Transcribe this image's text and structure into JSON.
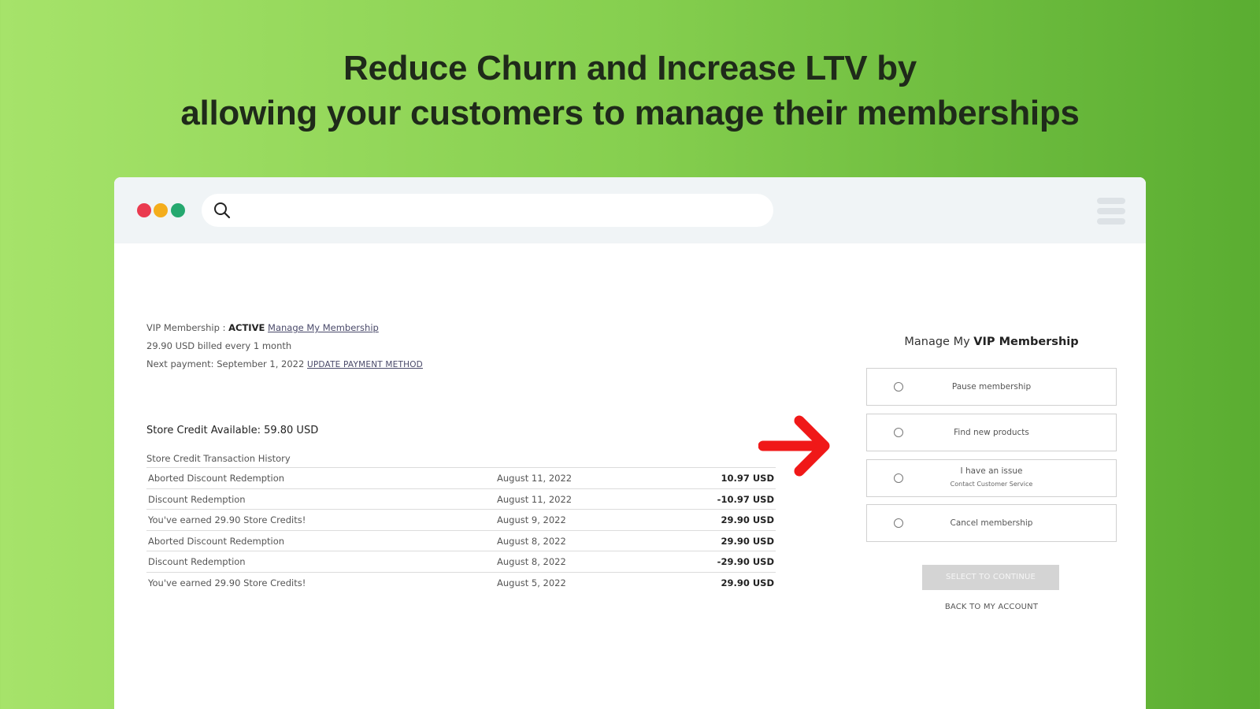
{
  "headline": {
    "line1": "Reduce Churn and Increase LTV by",
    "line2": "allowing your customers to manage their memberships"
  },
  "browser": {
    "search_placeholder": "",
    "dot_colors": [
      "#ea3a4f",
      "#f4ad1c",
      "#25a86f"
    ]
  },
  "membership": {
    "label": "VIP Membership : ",
    "status": "ACTIVE",
    "manage_link": "Manage My Membership",
    "billing": "29.90 USD billed every 1 month",
    "next_payment": "Next payment: September 1, 2022 ",
    "update_payment_link": "UPDATE PAYMENT METHOD"
  },
  "store_credit": {
    "available": "Store Credit Available: 59.80 USD",
    "history_title": "Store Credit Transaction History",
    "transactions": [
      {
        "description": "Aborted Discount Redemption",
        "date": "August 11, 2022",
        "amount": "10.97 USD"
      },
      {
        "description": "Discount Redemption",
        "date": "August 11, 2022",
        "amount": "-10.97 USD"
      },
      {
        "description": "You've earned 29.90 Store Credits!",
        "date": "August 9, 2022",
        "amount": "29.90 USD"
      },
      {
        "description": "Aborted Discount Redemption",
        "date": "August 8, 2022",
        "amount": "29.90 USD"
      },
      {
        "description": "Discount Redemption",
        "date": "August 8, 2022",
        "amount": "-29.90 USD"
      },
      {
        "description": "You've earned 29.90 Store Credits!",
        "date": "August 5, 2022",
        "amount": "29.90 USD"
      }
    ]
  },
  "manage_panel": {
    "title_prefix": "Manage My ",
    "title_bold": "VIP Membership",
    "options": [
      {
        "label": "Pause membership",
        "sub": ""
      },
      {
        "label": "Find new products",
        "sub": ""
      },
      {
        "label": "I have an issue",
        "sub": "Contact Customer Service"
      },
      {
        "label": "Cancel membership",
        "sub": ""
      }
    ],
    "continue_label": "SELECT TO CONTINUE",
    "back_label": "BACK TO MY ACCOUNT"
  },
  "colors": {
    "arrow": "#f01818",
    "disabled_button": "#d4d4d4"
  }
}
